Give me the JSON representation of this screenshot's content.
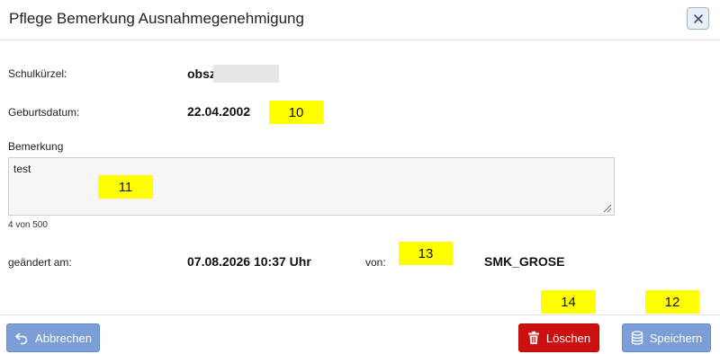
{
  "dialog": {
    "title": "Pflege Bemerkung Ausnahmegenehmigung",
    "close_icon": "close-icon"
  },
  "form": {
    "school_code": {
      "label": "Schulkürzel:",
      "value": "obsz"
    },
    "birth_date": {
      "label": "Geburtsdatum:",
      "value": "22.04.2002"
    },
    "remark": {
      "label": "Bemerkung",
      "value": "test",
      "counter": "4 von 500"
    },
    "changed_at": {
      "label": "geändert am:",
      "value": "07.08.2026 10:37 Uhr"
    },
    "changed_by": {
      "label": "von:",
      "value": "SMK_GROSE"
    }
  },
  "markers": [
    "10",
    "11",
    "13",
    "14",
    "12"
  ],
  "footer": {
    "cancel_label": "Abbrechen",
    "delete_label": "Löschen",
    "save_label": "Speichern"
  },
  "colors": {
    "primary_button": "#7b9ed6",
    "danger_button": "#cc0f0f",
    "marker": "#ffff00"
  }
}
